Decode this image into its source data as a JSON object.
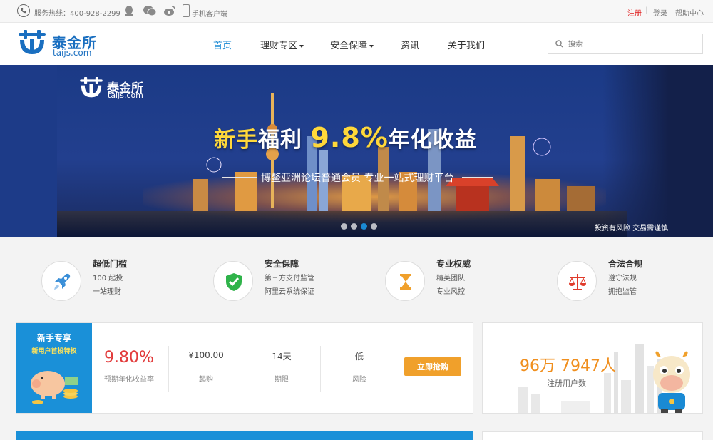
{
  "topbar": {
    "hotline": "服务热线：400-928-2299",
    "mobile_label": "手机客户端",
    "register": "注册",
    "separator": "|",
    "login": "登录",
    "help": "帮助中心"
  },
  "header": {
    "logo_cn": "泰金所",
    "logo_en": "taijs.com",
    "nav": [
      {
        "label": "首页",
        "active": true
      },
      {
        "label": "理财专区",
        "dropdown": true
      },
      {
        "label": "安全保障",
        "dropdown": true
      },
      {
        "label": "资讯"
      },
      {
        "label": "关于我们"
      }
    ],
    "search_placeholder": "搜索"
  },
  "banner": {
    "logo_cn": "泰金所",
    "logo_en": "taijs.com",
    "headline_a": "新手",
    "headline_b": "福利 ",
    "headline_pct": "9.8%",
    "headline_c": "年化收益",
    "subline": "博鳌亚洲论坛普通会员 专业一站式理财平台",
    "risk_note": "投资有风险 交易需谨慎",
    "slide_count": 4,
    "active_slide": 3
  },
  "features": [
    {
      "title": "超低门槛",
      "line1": "100 起投",
      "line2": "一站理财",
      "icon": "rocket-icon"
    },
    {
      "title": "安全保障",
      "line1": "第三方支付监管",
      "line2": "阿里云系统保证",
      "icon": "shield-icon"
    },
    {
      "title": "专业权威",
      "line1": "精英团队",
      "line2": "专业风控",
      "icon": "hourglass-icon"
    },
    {
      "title": "合法合规",
      "line1": "遵守法规",
      "line2": "拥抱监管",
      "icon": "scale-icon"
    }
  ],
  "product": {
    "side_title": "新手专享",
    "side_sub": "新用户首投特权",
    "rate": "9.80%",
    "rate_label": "预期年化收益率",
    "min": "¥100.00",
    "min_label": "起购",
    "term": "14天",
    "term_label": "期限",
    "risk": "低",
    "risk_label": "风险",
    "buy_label": "立即抢购"
  },
  "users": {
    "count": "96万 7947人",
    "label": "注册用户数"
  },
  "colors": {
    "brand_blue": "#1a6fc0",
    "accent_blue": "#1a8ad4",
    "orange": "#f0a02b",
    "red": "#e23b3b"
  }
}
